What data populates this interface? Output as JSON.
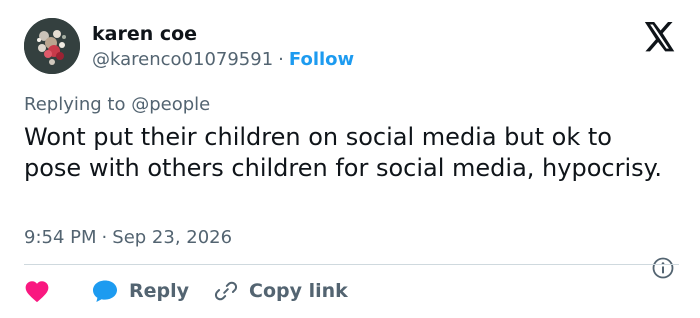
{
  "author": {
    "display_name": "karen coe",
    "handle": "@karenco01079591",
    "separator": "·",
    "follow_label": "Follow",
    "avatar_icon": "flower-photo-avatar"
  },
  "brand": {
    "logo_icon": "x-logo-icon"
  },
  "reply_context": {
    "prefix": "Replying to",
    "mention": "@people"
  },
  "tweet": {
    "text": "Wont put their children on social media but ok to pose with others children for social media, hypocrisy.",
    "time": "9:54 PM",
    "separator": "·",
    "date": "Sep 23, 2026"
  },
  "actions": {
    "like_icon": "heart-icon",
    "reply_icon": "speech-bubble-icon",
    "reply_label": "Reply",
    "copy_icon": "link-icon",
    "copy_label": "Copy link",
    "info_icon": "info-icon"
  },
  "colors": {
    "text_primary": "#0f1419",
    "text_secondary": "#536471",
    "link_blue": "#1d9bf0",
    "like_red": "#f91880",
    "divider": "#cfd9de"
  }
}
